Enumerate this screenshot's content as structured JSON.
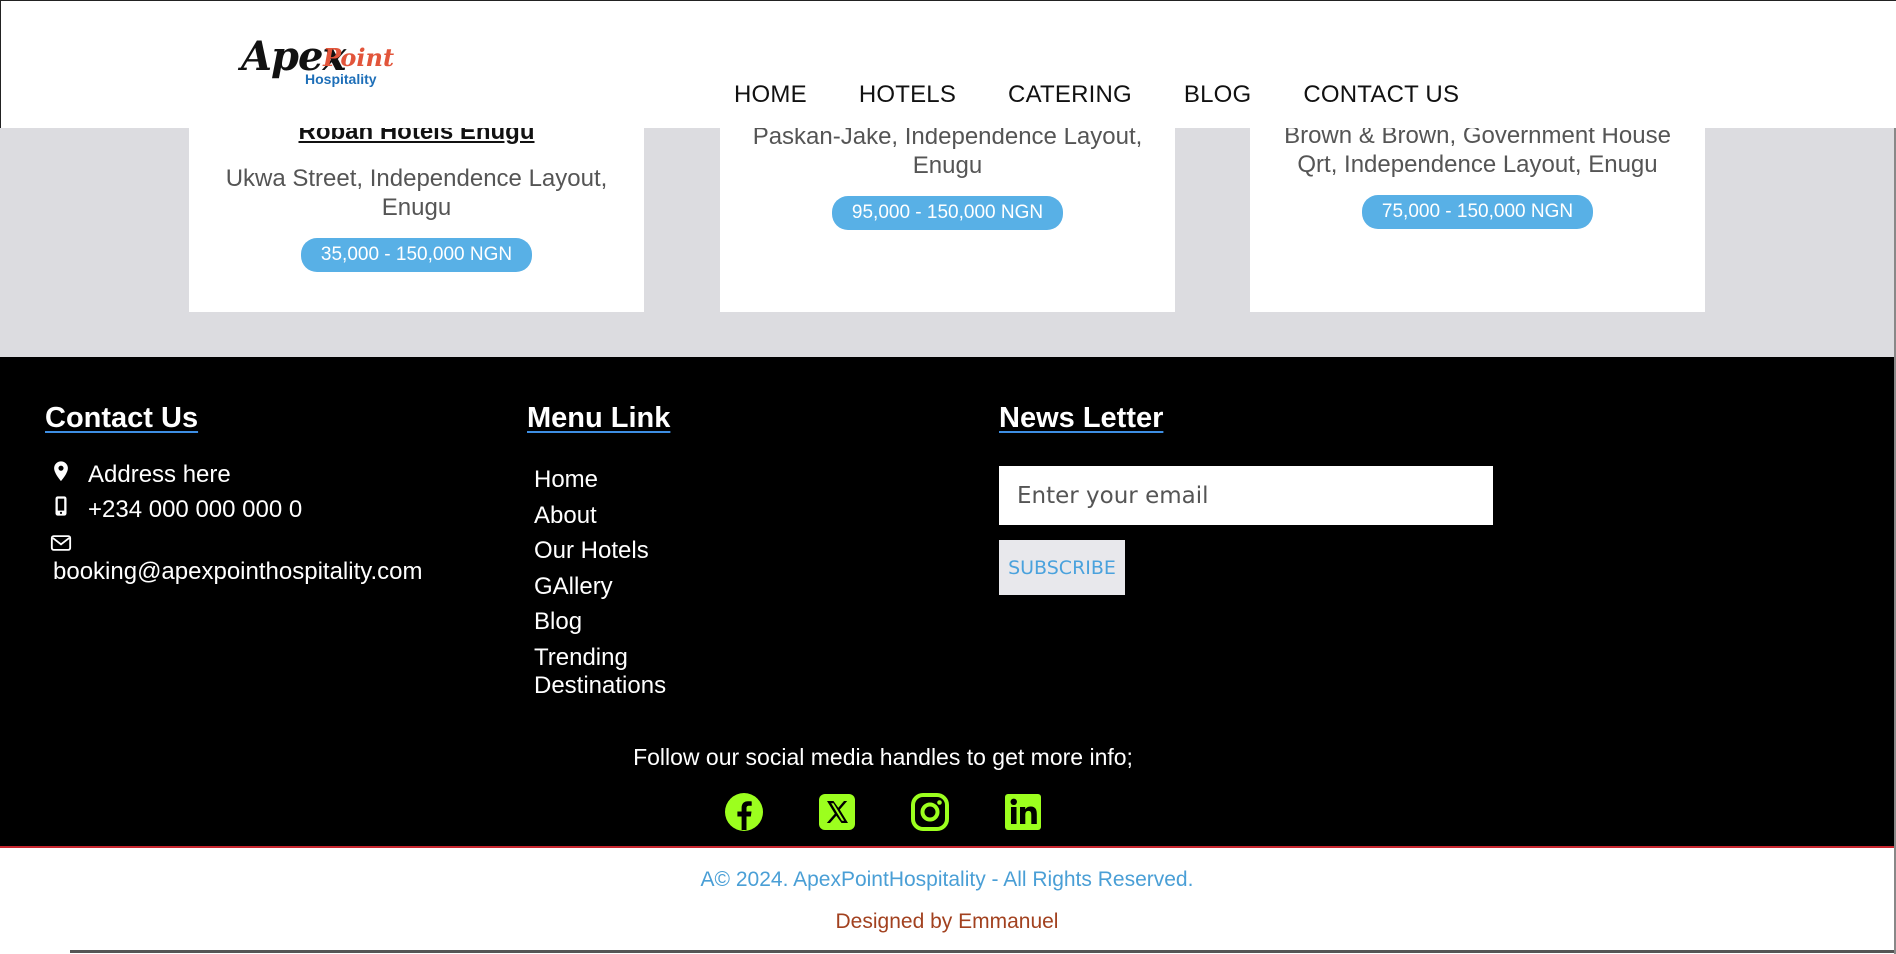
{
  "logo": {
    "apex": "Apex",
    "point": "Point",
    "hospitality": "Hospitality"
  },
  "nav": [
    {
      "label": "HOME"
    },
    {
      "label": "HOTELS"
    },
    {
      "label": "CATERING"
    },
    {
      "label": "BLOG"
    },
    {
      "label": "CONTACT US"
    }
  ],
  "hotels": [
    {
      "name": "Roban Hotels Enugu",
      "address": "Ukwa Street, Independence Layout, Enugu",
      "price": "35,000 - 150,000 NGN"
    },
    {
      "name": "",
      "address": "Paskan-Jake, Independence Layout, Enugu",
      "price": "95,000 - 150,000 NGN"
    },
    {
      "name": "",
      "address": "Brown & Brown, Government House Qrt, Independence Layout, Enugu",
      "price": "75,000 - 150,000 NGN"
    }
  ],
  "footer": {
    "contact": {
      "title": "Contact Us",
      "address": "Address here",
      "phone": "+234 000 000 000 0",
      "email": "booking@apexpointhospitality.com"
    },
    "menu": {
      "title": "Menu Link",
      "links": [
        "Home",
        "About",
        "Our Hotels",
        "GAllery",
        "Blog",
        "Trending Destinations"
      ]
    },
    "newsletter": {
      "title": "News Letter",
      "placeholder": "Enter your email",
      "button": "SUBSCRIBE"
    },
    "follow_text": "Follow our social media handles to get more info;",
    "socials": [
      "facebook-icon",
      "x-twitter-icon",
      "instagram-icon",
      "linkedin-icon"
    ],
    "social_color": "#9cff1e",
    "copyright": "A© 2024. ApexPointHospitality - All Rights Reserved.",
    "designed_by": "Designed by Emmanuel"
  },
  "colors": {
    "accent_blue": "#58b0e6",
    "footer_bg": "#000000",
    "band_bg": "#dcdce0",
    "copyright_text": "#4a9fd6",
    "designer_text": "#a2411f"
  }
}
